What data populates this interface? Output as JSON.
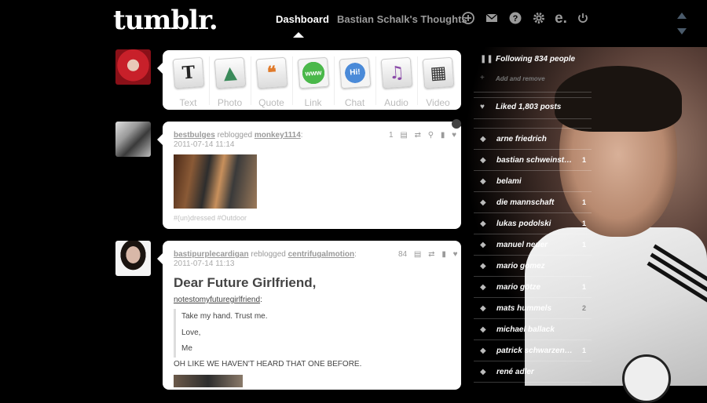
{
  "header": {
    "logo": "tumblr.",
    "nav_dashboard": "Dashboard",
    "nav_blog": "Bastian Schalk's Thoughts",
    "icons": [
      "plus-circle-icon",
      "mail-icon",
      "help-icon",
      "gear-icon",
      "e-icon",
      "power-icon"
    ]
  },
  "compose": {
    "types": [
      {
        "label": "Text",
        "glyph": "T",
        "color": "#222222"
      },
      {
        "label": "Photo",
        "glyph": "▲",
        "color": "#3a8a5a"
      },
      {
        "label": "Quote",
        "glyph": "❝",
        "color": "#e07a2a"
      },
      {
        "label": "Link",
        "glyph": "www",
        "color": "#3a9a3a"
      },
      {
        "label": "Chat",
        "glyph": "Hi!",
        "color": "#3a7ac8"
      },
      {
        "label": "Audio",
        "glyph": "♫",
        "color": "#8a4aa8"
      },
      {
        "label": "Video",
        "glyph": "▦",
        "color": "#333333"
      }
    ]
  },
  "posts": [
    {
      "user": "bestbulges",
      "action": "reblogged",
      "source": "monkey1114",
      "date": "2011-07-14 11:14",
      "notes": "1",
      "tags": "#(un)dressed   #Outdoor"
    },
    {
      "user": "bastipurplecardigan",
      "action": "reblogged",
      "source": "centrifugalmotion",
      "date": "2011-07-14 11:13",
      "notes": "84",
      "title": "Dear Future Girlfriend,",
      "source_link": "notestomyfuturegirlfriend",
      "quote_lines": [
        "Take my hand. Trust me.",
        "Love,",
        "Me"
      ],
      "text": "OH LIKE WE HAVEN'T HEARD THAT ONE BEFORE."
    }
  ],
  "sidebar": {
    "following": "Following 834 people",
    "add_remove": "Add and remove",
    "liked": "Liked 1,803 posts",
    "tags": [
      {
        "name": "arne friedrich",
        "count": ""
      },
      {
        "name": "bastian schweinsteiger",
        "count": "1"
      },
      {
        "name": "belami",
        "count": ""
      },
      {
        "name": "die mannschaft",
        "count": "1"
      },
      {
        "name": "lukas podolski",
        "count": "1"
      },
      {
        "name": "manuel neuer",
        "count": "1"
      },
      {
        "name": "mario gomez",
        "count": ""
      },
      {
        "name": "mario götze",
        "count": "1"
      },
      {
        "name": "mats hummels",
        "count": "2"
      },
      {
        "name": "michael ballack",
        "count": ""
      },
      {
        "name": "patrick schwarzenegger",
        "count": "1"
      },
      {
        "name": "rené adler",
        "count": ""
      }
    ]
  }
}
